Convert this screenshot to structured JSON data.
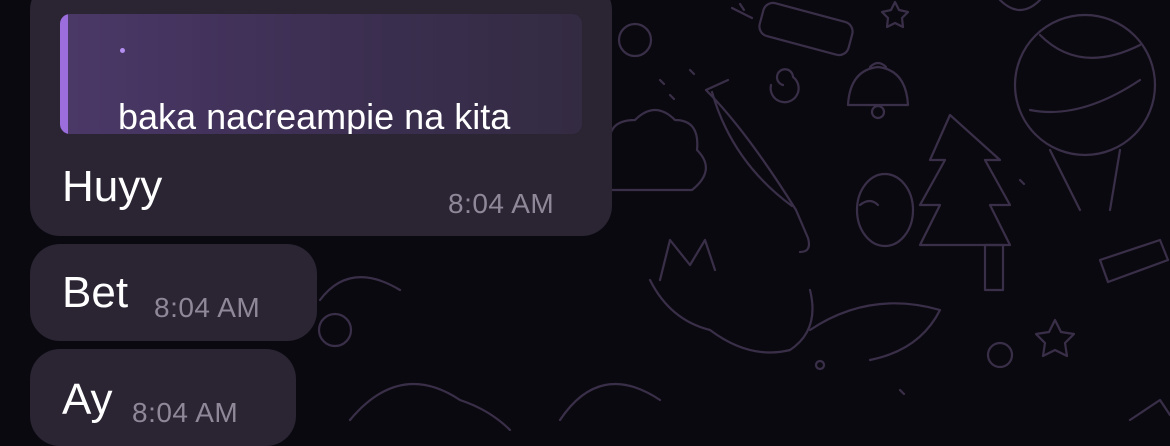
{
  "messages": [
    {
      "reply": {
        "author": "",
        "text": "baka nacreampie na kita"
      },
      "text": "Huyy",
      "time": "8:04 AM"
    },
    {
      "text": "Bet",
      "time": "8:04 AM"
    },
    {
      "text": "Ay",
      "time": "8:04 AM"
    }
  ],
  "colors": {
    "background": "#0b0910",
    "bubble": "#2a2433",
    "reply_accent": "#9b6ddd",
    "time_text": "#8e8899"
  }
}
